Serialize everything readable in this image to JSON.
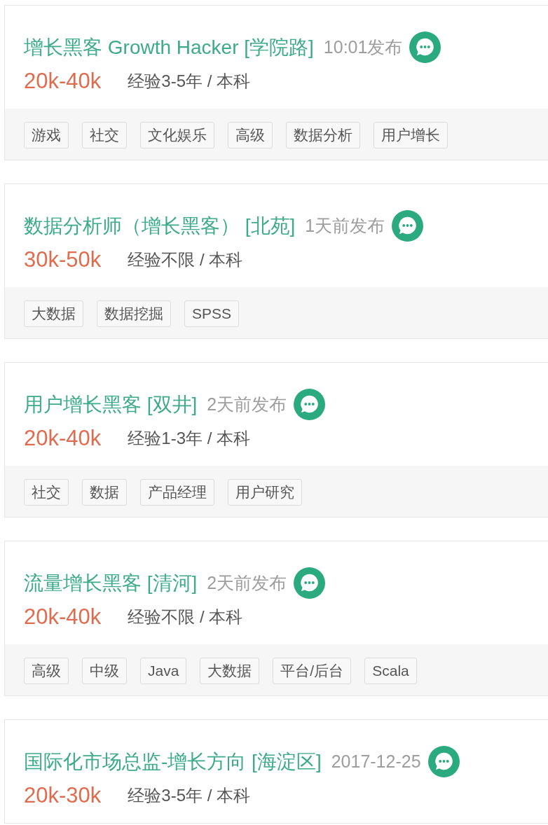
{
  "jobs": [
    {
      "title": "增长黑客 Growth Hacker [学院路]",
      "posted": "10:01发布",
      "salary": "20k-40k",
      "requirements": "经验3-5年 / 本科",
      "tags": [
        "游戏",
        "社交",
        "文化娱乐",
        "高级",
        "数据分析",
        "用户增长"
      ]
    },
    {
      "title": "数据分析师（增长黑客） [北苑]",
      "posted": "1天前发布",
      "salary": "30k-50k",
      "requirements": "经验不限 / 本科",
      "tags": [
        "大数据",
        "数据挖掘",
        "SPSS"
      ]
    },
    {
      "title": "用户增长黑客 [双井]",
      "posted": "2天前发布",
      "salary": "20k-40k",
      "requirements": "经验1-3年 / 本科",
      "tags": [
        "社交",
        "数据",
        "产品经理",
        "用户研究"
      ]
    },
    {
      "title": "流量增长黑客 [清河]",
      "posted": "2天前发布",
      "salary": "20k-40k",
      "requirements": "经验不限 / 本科",
      "tags": [
        "高级",
        "中级",
        "Java",
        "大数据",
        "平台/后台",
        "Scala"
      ]
    },
    {
      "title": "国际化市场总监-增长方向 [海淀区]",
      "posted": "2017-12-25",
      "salary": "20k-30k",
      "requirements": "经验3-5年 / 本科"
    }
  ]
}
